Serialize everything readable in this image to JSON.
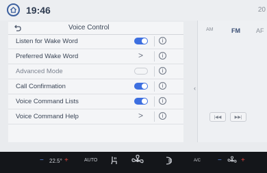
{
  "status": {
    "time": "19:46",
    "outside_temp": "20"
  },
  "voice_control": {
    "title": "Voice Control",
    "rows": [
      {
        "label": "Listen for Wake Word",
        "control": "toggle",
        "state": "on"
      },
      {
        "label": "Preferred Wake Word",
        "control": "chevron",
        "chevron": ">"
      },
      {
        "label": "Advanced Mode",
        "control": "toggle",
        "state": "off"
      },
      {
        "label": "Call Confirmation",
        "control": "toggle",
        "state": "on"
      },
      {
        "label": "Voice Command Lists",
        "control": "toggle",
        "state": "on"
      },
      {
        "label": "Voice Command Help",
        "control": "chevron",
        "chevron": ">"
      }
    ],
    "info_glyph": "i"
  },
  "radio": {
    "tabs": [
      "AM",
      "FM",
      "AF"
    ],
    "active_tab": "FM",
    "seek_back": "|◀◀",
    "seek_forward": "▶▶|"
  },
  "climate": {
    "driver_temp": "22.5°",
    "minus": "−",
    "plus": "+",
    "auto": "AUTO",
    "ac": "A/C"
  },
  "colors": {
    "accent": "#3d6fe0",
    "home_ring": "#3b5f9e",
    "cool": "#5b8ef0",
    "warm": "#e0463e"
  }
}
